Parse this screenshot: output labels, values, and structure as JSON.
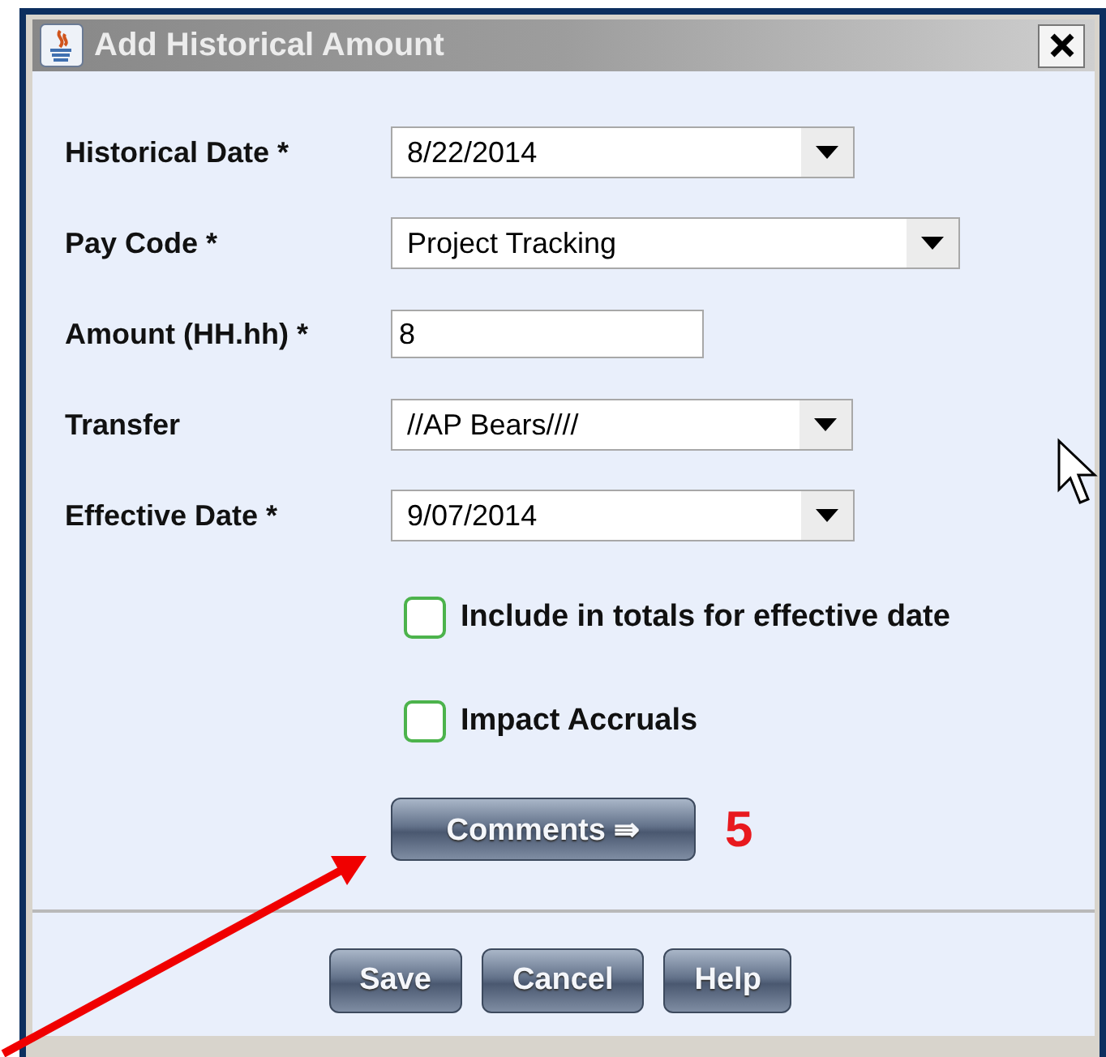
{
  "window": {
    "title": "Add Historical Amount"
  },
  "fields": [
    {
      "kind": "dropdown",
      "label": "Historical Date *",
      "value": "8/22/2014"
    },
    {
      "kind": "dropdown",
      "label": "Pay Code *",
      "value": "Project Tracking"
    },
    {
      "kind": "text",
      "label": "Amount (HH.hh) *",
      "value": "8"
    },
    {
      "kind": "dropdown",
      "label": "Transfer",
      "value": "//AP Bears////"
    },
    {
      "kind": "dropdown",
      "label": "Effective Date *",
      "value": "9/07/2014"
    }
  ],
  "checkboxes": [
    {
      "label": "Include in totals for effective date",
      "checked": false
    },
    {
      "label": "Impact Accruals",
      "checked": false
    }
  ],
  "comments_button": {
    "label": "Comments ⇛"
  },
  "annotation": {
    "number": "5"
  },
  "buttons": [
    "Save",
    "Cancel",
    "Help"
  ]
}
